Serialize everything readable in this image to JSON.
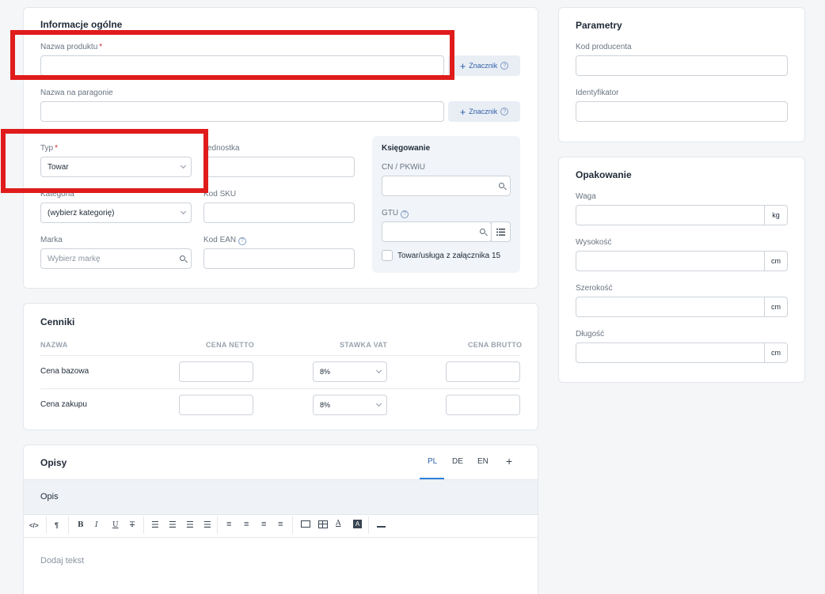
{
  "general": {
    "title": "Informacje ogólne",
    "product_name_label": "Nazwa produktu",
    "receipt_name_label": "Nazwa na paragonie",
    "tag_button": "Znacznik",
    "type_label": "Typ",
    "type_value": "Towar",
    "unit_label": "Jednostka",
    "category_label": "Kategoria",
    "category_value": "(wybierz kategorię)",
    "sku_label": "Kod SKU",
    "brand_label": "Marka",
    "brand_placeholder": "Wybierz markę",
    "ean_label": "Kod EAN",
    "accounting": {
      "title": "Księgowanie",
      "cn_label": "CN / PKWiU",
      "gtu_label": "GTU",
      "checkbox_label": "Towar/usługa z załącznika 15"
    }
  },
  "prices": {
    "title": "Cenniki",
    "headers": [
      "NAZWA",
      "CENA NETTO",
      "STAWKA VAT",
      "CENA BRUTTO"
    ],
    "rows": [
      {
        "name": "Cena bazowa",
        "vat": "8%"
      },
      {
        "name": "Cena zakupu",
        "vat": "8%"
      }
    ]
  },
  "descriptions": {
    "title": "Opisy",
    "tabs": [
      "PL",
      "DE",
      "EN"
    ],
    "active_tab": "PL",
    "add_tab": "+",
    "section": "Opis",
    "placeholder": "Dodaj tekst"
  },
  "parameters": {
    "title": "Parametry",
    "producer_code_label": "Kod producenta",
    "identifier_label": "Identyfikator"
  },
  "packaging": {
    "title": "Opakowanie",
    "weight_label": "Waga",
    "weight_unit": "kg",
    "height_label": "Wysokość",
    "height_unit": "cm",
    "width_label": "Szerokość",
    "width_unit": "cm",
    "length_label": "Długość",
    "length_unit": "cm"
  },
  "colors": {
    "accent": "#2f5ea8",
    "highlight": "#e01b1b",
    "required": "#d62c2c"
  }
}
